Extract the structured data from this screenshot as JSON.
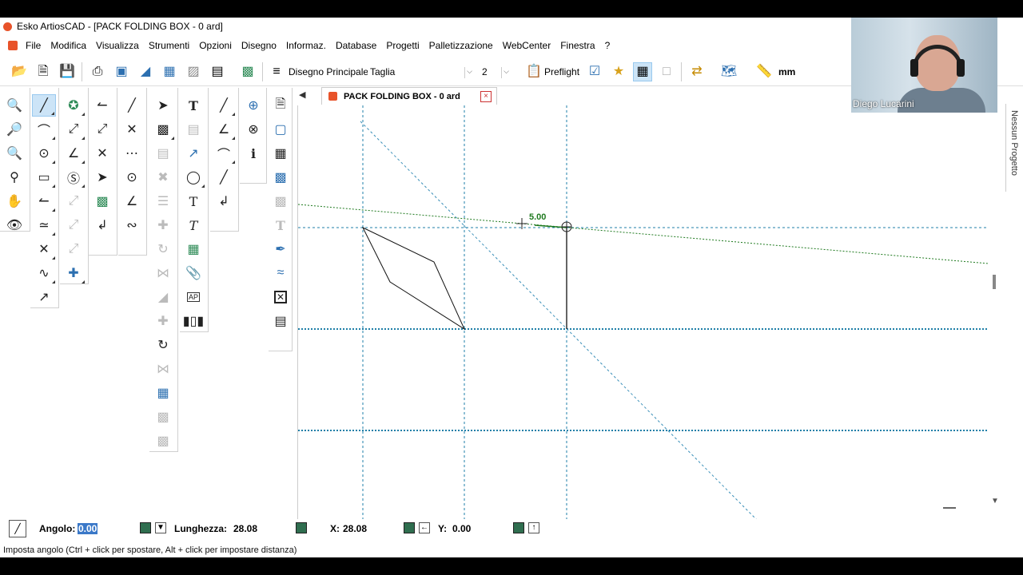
{
  "window": {
    "title": "Esko ArtiosCAD - [PACK FOLDING BOX - 0 ard]"
  },
  "menu": [
    "File",
    "Modifica",
    "Visualizza",
    "Strumenti",
    "Opzioni",
    "Disegno",
    "Informaz.",
    "Database",
    "Progetti",
    "Palletizzazione",
    "WebCenter",
    "Finestra",
    "?"
  ],
  "toolbar": {
    "design_label": "Disegno Principale",
    "layer_select": "Taglia",
    "line_select": "2",
    "preflight_label": "Preflight",
    "units_label": "mm"
  },
  "tab": {
    "label": "PACK FOLDING BOX - 0 ard",
    "close": "×"
  },
  "side_panel": {
    "label": "Nessun Progetto"
  },
  "canvas": {
    "dimension_label": "5.00"
  },
  "status": {
    "angle_label": "Angolo:",
    "angle_value": "0.00",
    "length_label": "Lunghezza:",
    "length_value": "28.08",
    "x_label": "X:",
    "x_value": "28.08",
    "y_label": "Y:",
    "y_value": "0.00"
  },
  "hint": "Imposta angolo (Ctrl + click per spostare, Alt + click per impostare distanza)",
  "webcam": {
    "name": "Diego Lucarini"
  },
  "colors": {
    "accent": "#e8532a",
    "guide": "#1f7fa8",
    "dim": "#1f7a1f"
  }
}
